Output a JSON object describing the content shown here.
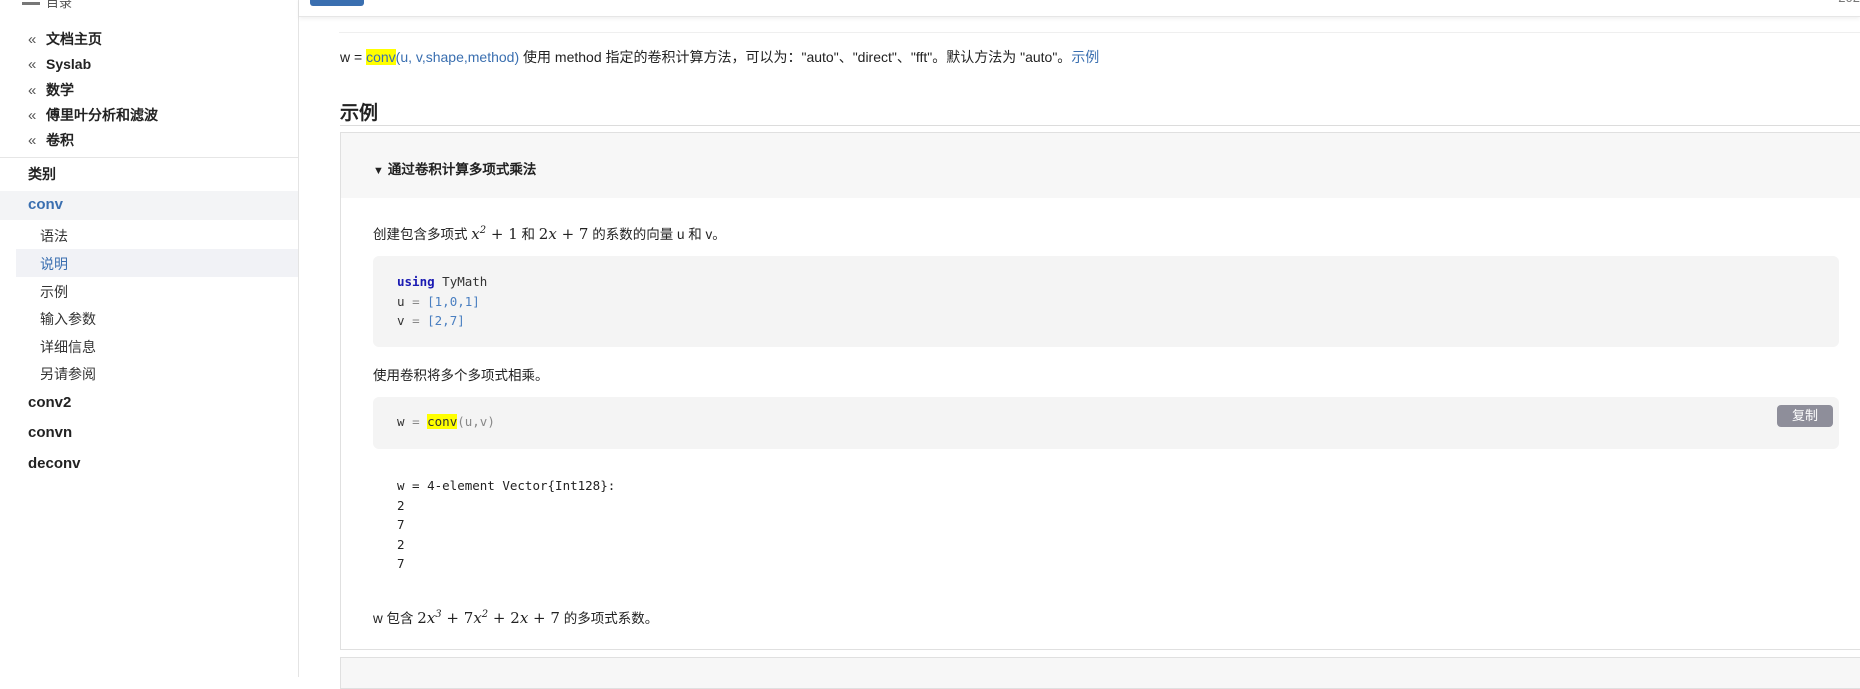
{
  "sidebar": {
    "top_cut_label": "目录",
    "breadcrumbs": [
      {
        "label": "文档主页"
      },
      {
        "label": "Syslab"
      },
      {
        "label": "数学"
      },
      {
        "label": "傅里叶分析和滤波"
      },
      {
        "label": "卷积"
      }
    ],
    "category_label": "类别",
    "functions": [
      {
        "label": "conv",
        "active": true
      },
      {
        "label": "conv2"
      },
      {
        "label": "convn"
      },
      {
        "label": "deconv"
      }
    ],
    "sections": [
      {
        "label": "语法"
      },
      {
        "label": "说明",
        "active": true
      },
      {
        "label": "示例"
      },
      {
        "label": "输入参数"
      },
      {
        "label": "详细信息"
      },
      {
        "label": "另请参阅"
      }
    ]
  },
  "topbar": {
    "right_text": "202"
  },
  "syntax": {
    "prefix": "w = ",
    "fn": "conv",
    "args": "(u, v,shape,method)",
    "desc": " 使用 method 指定的卷积计算方法，可以为：\"auto\"、\"direct\"、\"fft\"。默认方法为 \"auto\"。",
    "link": "示例"
  },
  "examples_heading": "示例",
  "example": {
    "title": "通过卷积计算多项式乘法",
    "intro": {
      "pre": "创建包含多项式 ",
      "mid": " 和 ",
      "post": " 的系数的向量 u 和 v。"
    },
    "code1": {
      "keyword": "using",
      "module": " TyMath",
      "u_var": "u ",
      "u_eq": "= ",
      "u_val": "[1,0,1]",
      "v_var": "v ",
      "v_eq": "= ",
      "v_val": "[2,7]"
    },
    "para2": "使用卷积将多个多项式相乘。",
    "code2": {
      "var": "w ",
      "eq": "= ",
      "fn": "conv",
      "args": "(u,v)"
    },
    "copy_label": "复制",
    "output_lines": [
      "w = 4-element Vector{Int128}:",
      "2",
      "7",
      "2",
      "7"
    ],
    "conclusion": {
      "pre": "w 包含 ",
      "post": " 的多项式系数。"
    }
  }
}
